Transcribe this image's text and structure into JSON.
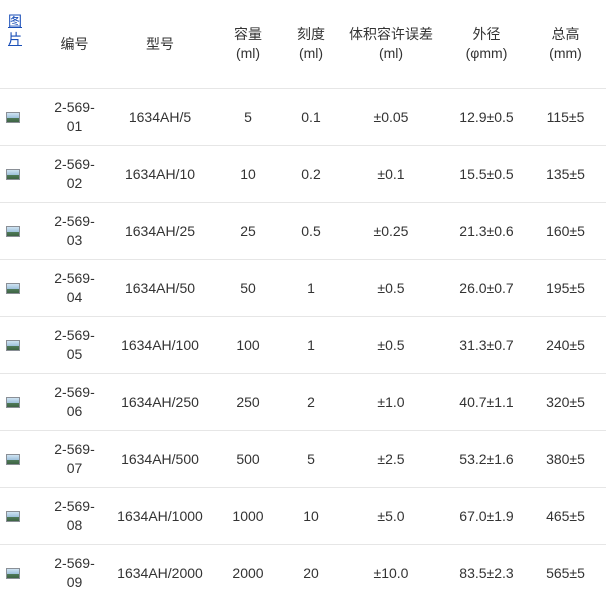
{
  "header": {
    "picture": "图片",
    "code": "编号",
    "model": "型号",
    "capacity": "容量",
    "capacity_unit": "(ml)",
    "graduation": "刻度",
    "graduation_unit": "(ml)",
    "tolerance": "体积容许误差",
    "tolerance_unit": "(ml)",
    "outer_diameter": "外径",
    "outer_diameter_unit": "(φmm)",
    "total_height": "总高",
    "total_height_unit": "(mm)"
  },
  "rows": [
    {
      "code": "2-569-01",
      "model": "1634AH/5",
      "capacity": "5",
      "graduation": "0.1",
      "tolerance": "±0.05",
      "diameter": "12.9±0.5",
      "height": "115±5"
    },
    {
      "code": "2-569-02",
      "model": "1634AH/10",
      "capacity": "10",
      "graduation": "0.2",
      "tolerance": "±0.1",
      "diameter": "15.5±0.5",
      "height": "135±5"
    },
    {
      "code": "2-569-03",
      "model": "1634AH/25",
      "capacity": "25",
      "graduation": "0.5",
      "tolerance": "±0.25",
      "diameter": "21.3±0.6",
      "height": "160±5"
    },
    {
      "code": "2-569-04",
      "model": "1634AH/50",
      "capacity": "50",
      "graduation": "1",
      "tolerance": "±0.5",
      "diameter": "26.0±0.7",
      "height": "195±5"
    },
    {
      "code": "2-569-05",
      "model": "1634AH/100",
      "capacity": "100",
      "graduation": "1",
      "tolerance": "±0.5",
      "diameter": "31.3±0.7",
      "height": "240±5"
    },
    {
      "code": "2-569-06",
      "model": "1634AH/250",
      "capacity": "250",
      "graduation": "2",
      "tolerance": "±1.0",
      "diameter": "40.7±1.1",
      "height": "320±5"
    },
    {
      "code": "2-569-07",
      "model": "1634AH/500",
      "capacity": "500",
      "graduation": "5",
      "tolerance": "±2.5",
      "diameter": "53.2±1.6",
      "height": "380±5"
    },
    {
      "code": "2-569-08",
      "model": "1634AH/1000",
      "capacity": "1000",
      "graduation": "10",
      "tolerance": "±5.0",
      "diameter": "67.0±1.9",
      "height": "465±5"
    },
    {
      "code": "2-569-09",
      "model": "1634AH/2000",
      "capacity": "2000",
      "graduation": "20",
      "tolerance": "±10.0",
      "diameter": "83.5±2.3",
      "height": "565±5"
    }
  ]
}
